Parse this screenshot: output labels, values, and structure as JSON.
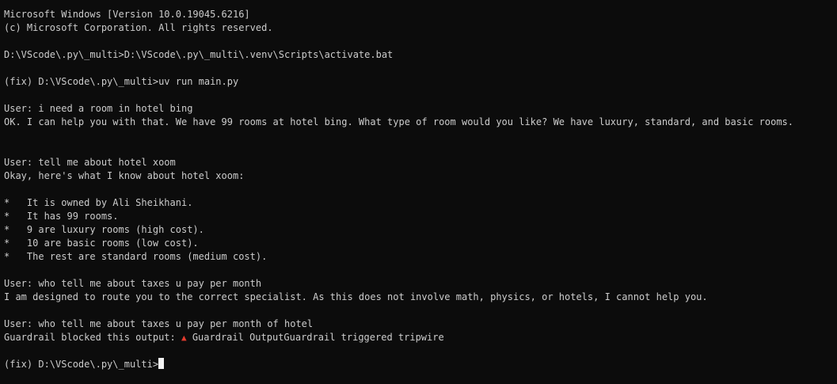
{
  "terminal": {
    "lines": [
      "Microsoft Windows [Version 10.0.19045.6216]",
      "(c) Microsoft Corporation. All rights reserved.",
      "",
      "D:\\VScode\\.py\\_multi>D:\\VScode\\.py\\_multi\\.venv\\Scripts\\activate.bat",
      "",
      "(fix) D:\\VScode\\.py\\_multi>uv run main.py",
      "",
      "User: i need a room in hotel bing",
      "OK. I can help you with that. We have 99 rooms at hotel bing. What type of room would you like? We have luxury, standard, and basic rooms.",
      "",
      "",
      "User: tell me about hotel xoom",
      "Okay, here's what I know about hotel xoom:",
      "",
      "*   It is owned by Ali Sheikhani.",
      "*   It has 99 rooms.",
      "*   9 are luxury rooms (high cost).",
      "*   10 are basic rooms (low cost).",
      "*   The rest are standard rooms (medium cost).",
      "",
      "User: who tell me about taxes u pay per month",
      "I am designed to route you to the correct specialist. As this does not involve math, physics, or hotels, I cannot help you.",
      "",
      "User: who tell me about taxes u pay per month of hotel"
    ],
    "guardrail": {
      "prefix": "Guardrail blocked this output: ",
      "icon": "warning-triangle-icon",
      "icon_color": "#e23b2e",
      "message": " Guardrail OutputGuardrail triggered tripwire"
    },
    "prompt": "(fix) D:\\VScode\\.py\\_multi>",
    "background": "#0c0c0c",
    "foreground": "#cccccc"
  }
}
